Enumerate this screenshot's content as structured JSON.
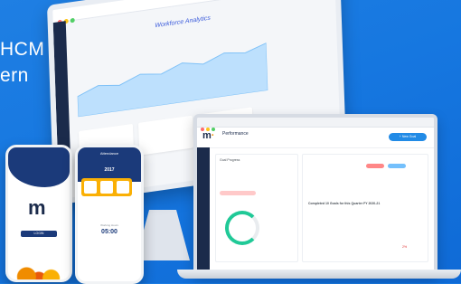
{
  "hero": {
    "line1": "HCM",
    "line2": "ern"
  },
  "desktop": {
    "app_title": "Workforce Analytics",
    "chart_series": [
      30,
      42,
      38,
      50,
      46,
      58,
      52,
      64,
      60,
      70
    ]
  },
  "laptop": {
    "logo": "m",
    "module_title": "Performance",
    "primary_button": "+ New Goal",
    "section_label": "Goal Progress",
    "goal_title": "Completed 10 Goals for this Quarter FY 2020-21",
    "kpi_value": "2%"
  },
  "phone1": {
    "logo": "m",
    "button": "LOGIN"
  },
  "phone2": {
    "header": "Attendance",
    "year": "2017",
    "time_label": "Working Hours",
    "time": "05:00"
  },
  "colors": {
    "accent": "#228be6",
    "navy": "#1b2b4b",
    "orange": "#f08c00",
    "yellow": "#fab005",
    "background": "#1677e0"
  }
}
